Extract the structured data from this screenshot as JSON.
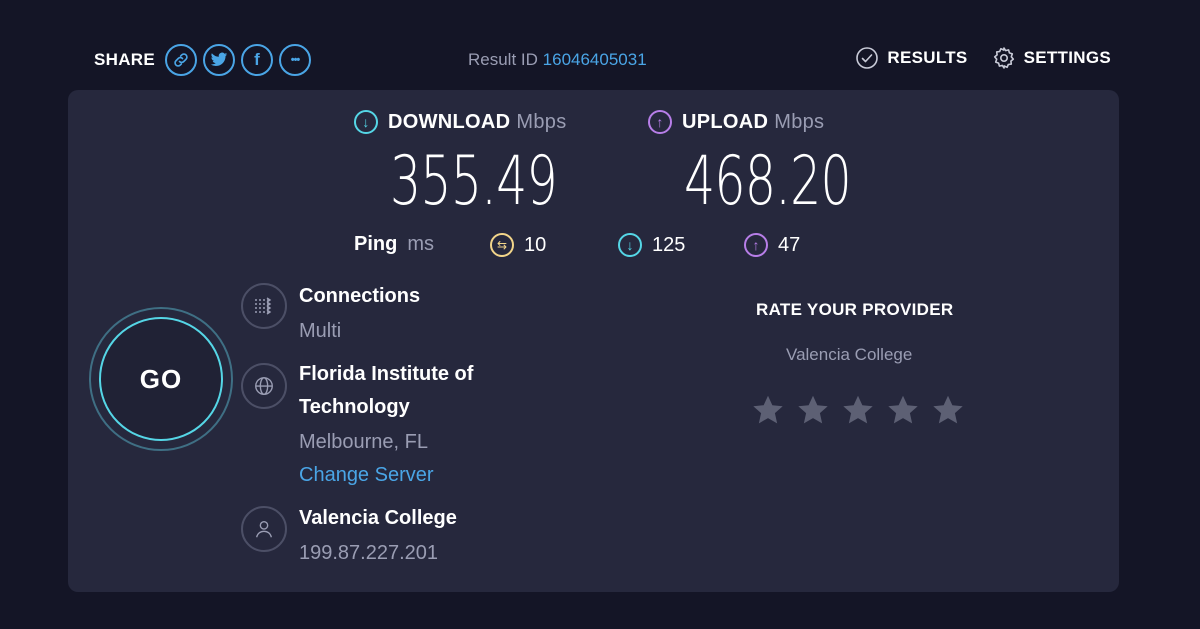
{
  "header": {
    "share_label": "SHARE",
    "share_buttons": [
      {
        "icon": "link-icon",
        "glyph": ""
      },
      {
        "icon": "twitter-icon",
        "glyph": ""
      },
      {
        "icon": "facebook-icon",
        "glyph": "f"
      },
      {
        "icon": "more-icon",
        "glyph": "•••"
      }
    ],
    "result_id_label": "Result ID",
    "result_id": "16046405031",
    "results_label": "RESULTS",
    "settings_label": "SETTINGS"
  },
  "download": {
    "label": "DOWNLOAD",
    "unit": "Mbps",
    "value": "355.49",
    "color": "#55d6e6"
  },
  "upload": {
    "label": "UPLOAD",
    "unit": "Mbps",
    "value": "468.20",
    "color": "#b77ee8"
  },
  "ping": {
    "label": "Ping",
    "unit": "ms",
    "idle": "10",
    "download": "125",
    "upload": "47",
    "idle_color": "#f2d58a"
  },
  "go_label": "GO",
  "connections": {
    "title": "Connections",
    "value": "Multi"
  },
  "server": {
    "name_line1": "Florida Institute of",
    "name_line2": "Technology",
    "location": "Melbourne, FL",
    "change_label": "Change Server"
  },
  "provider": {
    "name": "Valencia College",
    "ip": "199.87.227.201"
  },
  "rating": {
    "title": "RATE YOUR PROVIDER",
    "provider": "Valencia College",
    "stars_max": 5,
    "stars_selected": 0
  },
  "colors": {
    "accent": "#4aa5e6",
    "background": "#141526",
    "panel": "#26283d",
    "muted": "#9a9db3",
    "star": "#5d6074"
  }
}
